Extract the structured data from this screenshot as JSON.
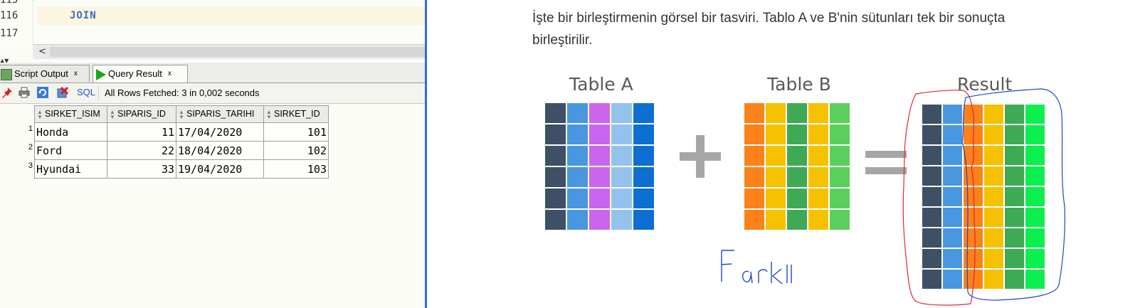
{
  "editor": {
    "lines": [
      {
        "num": "116",
        "code": "JOIN"
      },
      {
        "num": "117",
        "code": ""
      }
    ],
    "scroll_left": "<"
  },
  "tabs": {
    "script_output": "Script Output",
    "query_result": "Query Result",
    "close": "x"
  },
  "toolbar": {
    "sql": "SQL",
    "status": "All Rows Fetched: 3 in 0,002 seconds"
  },
  "results": {
    "columns": [
      "SIRKET_ISIM",
      "SIPARIS_ID",
      "SIPARIS_TARIHI",
      "SIRKET_ID"
    ],
    "rows": [
      [
        "1",
        "Honda",
        "11",
        "17/04/2020",
        "101"
      ],
      [
        "2",
        "Ford",
        "22",
        "18/04/2020",
        "102"
      ],
      [
        "3",
        "Hyundai",
        "33",
        "19/04/2020",
        "103"
      ]
    ]
  },
  "article": {
    "text": "İşte bir birleştirmenin görsel bir tasviri. Tablo A ve B'nin sütunları tek bir sonuçta birleştirilir.",
    "table_a_title": "Table A",
    "table_b_title": "Table B",
    "result_title": "Result",
    "handwritten_note": "Farklı",
    "table_a_colors": [
      "#3f4f66",
      "#4897e0",
      "#c965ee",
      "#93c3ec",
      "#0c6fd1"
    ],
    "table_b_colors": [
      "#fb8119",
      "#f5c100",
      "#3faa55",
      "#f5c100",
      "#5bcf5b"
    ],
    "result_colors": [
      "#3f4f66",
      "#4897e0",
      "#fb8119",
      "#f5c100",
      "#3faa55",
      "#0cf04f"
    ],
    "operator_color": "#a6a6a6",
    "red_marker": "#e0253a",
    "blue_marker": "#2244cc"
  }
}
